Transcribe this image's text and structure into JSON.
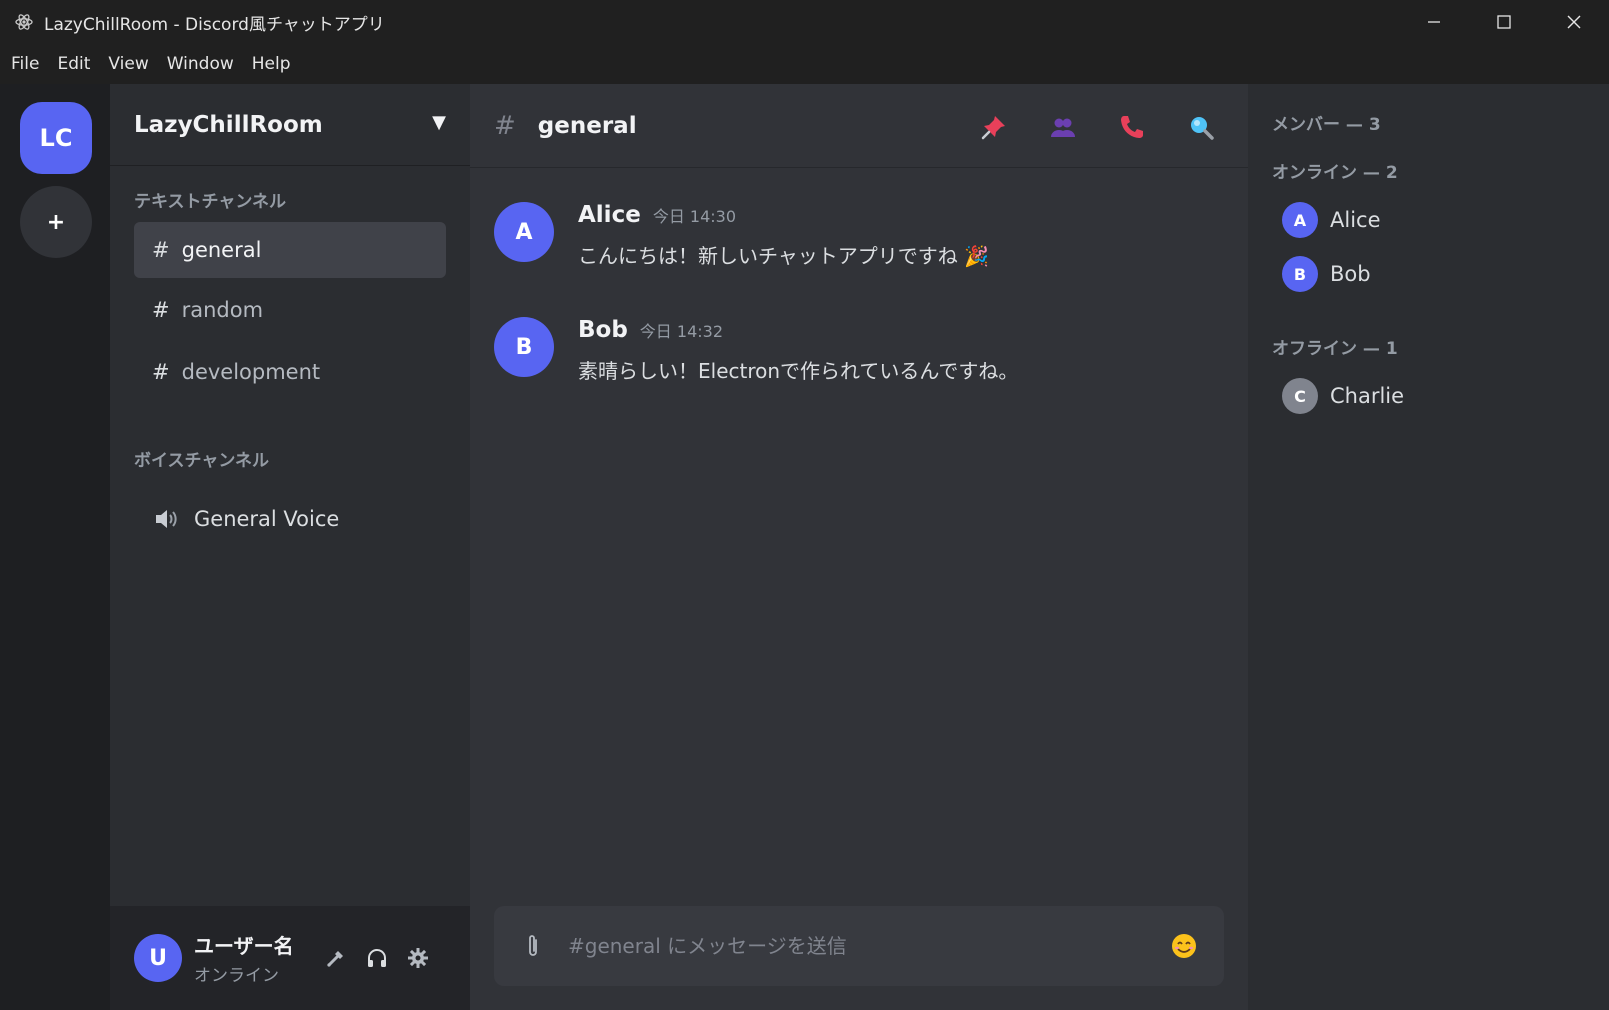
{
  "window": {
    "title": "LazyChillRoom - Discord風チャットアプリ"
  },
  "menu": [
    "File",
    "Edit",
    "View",
    "Window",
    "Help"
  ],
  "servers": [
    {
      "label": "LC",
      "color": "#5865f2"
    },
    {
      "label": "+"
    }
  ],
  "sidebar": {
    "server_name": "LazyChillRoom",
    "dropdown": "▼",
    "text_category": "テキストチャンネル",
    "text_channels": [
      {
        "hash": "#",
        "name": "general",
        "active": true
      },
      {
        "hash": "#",
        "name": "random"
      },
      {
        "hash": "#",
        "name": "development"
      }
    ],
    "voice_category": "ボイスチャンネル",
    "voice_channels": [
      {
        "name": "General Voice",
        "icon": "speaker-icon"
      }
    ]
  },
  "user_panel": {
    "avatar": "U",
    "name": "ユーザー名",
    "status": "オンライン",
    "controls": [
      "mic-icon",
      "headphones-icon",
      "settings-icon"
    ]
  },
  "chat": {
    "hash": "#",
    "channel": "general",
    "header_icons": [
      "pin-icon",
      "members-icon",
      "call-icon",
      "search-icon"
    ],
    "messages": [
      {
        "avatar": "A",
        "author": "Alice",
        "time": "今日 14:30",
        "text": "こんにちは！新しいチャットアプリですね 🎉"
      },
      {
        "avatar": "B",
        "author": "Bob",
        "time": "今日 14:32",
        "text": "素晴らしい！Electronで作られているんですね。"
      }
    ],
    "composer": {
      "placeholder": "#general にメッセージを送信",
      "value": "",
      "emoji": "😊"
    }
  },
  "members": {
    "header": "メンバー — 3",
    "online_header": "オンライン — 2",
    "online": [
      {
        "avatar": "A",
        "name": "Alice",
        "color": "#5865f2"
      },
      {
        "avatar": "B",
        "name": "Bob",
        "color": "#5865f2"
      }
    ],
    "offline_header": "オフライン — 1",
    "offline": [
      {
        "avatar": "C",
        "name": "Charlie",
        "color": "#80848e"
      }
    ]
  }
}
